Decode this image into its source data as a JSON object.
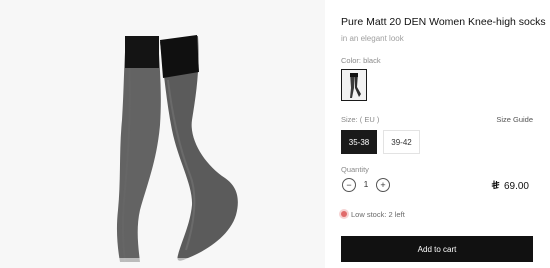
{
  "product": {
    "title": "Pure Matt 20 DEN Women Knee-high socks",
    "subtitle": "in an elegant look",
    "image_icon": "sheer-knee-high-socks-photo"
  },
  "color": {
    "label": "Color: black",
    "selected_swatch": "black",
    "swatch_color": "#1a1a1a"
  },
  "size": {
    "label": "Size: ( EU )",
    "guide_label": "Size Guide",
    "options": [
      "35-38",
      "39-42"
    ],
    "selected": "35-38"
  },
  "quantity": {
    "label": "Quantity",
    "value": "1",
    "minus_symbol": "−",
    "plus_symbol": "+"
  },
  "price": {
    "amount": "69.00",
    "currency_icon": "saudi-riyal-icon"
  },
  "stock": {
    "text": "Low stock: 2 left",
    "status_color": "#e06a6a"
  },
  "cart": {
    "label": "Add to cart",
    "button_color": "#111111"
  }
}
